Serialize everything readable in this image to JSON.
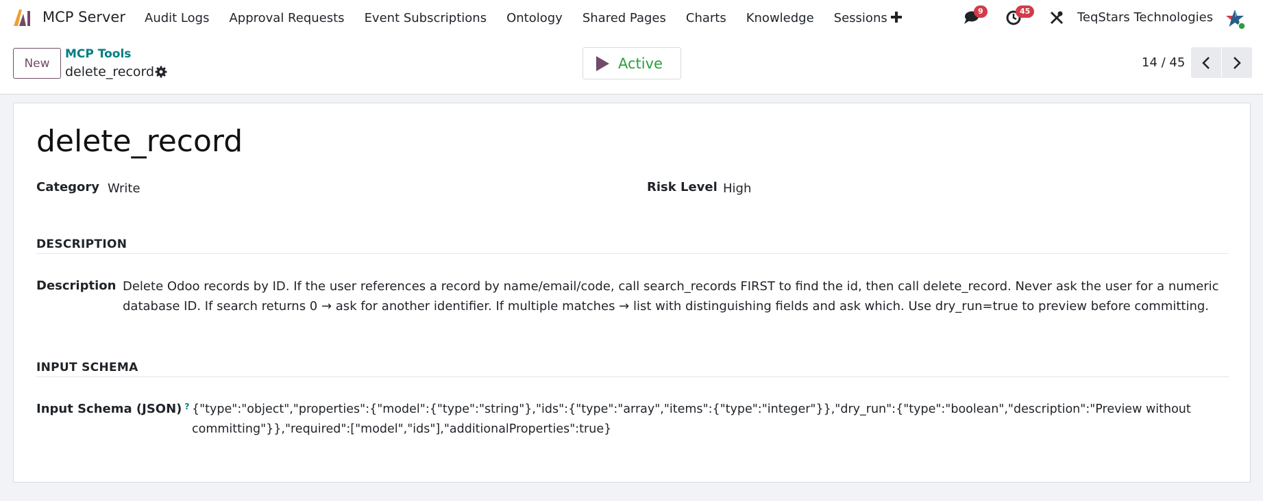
{
  "navbar": {
    "app_name": "MCP Server",
    "menu": [
      "Audit Logs",
      "Approval Requests",
      "Event Subscriptions",
      "Ontology",
      "Shared Pages",
      "Charts",
      "Knowledge",
      "Sessions"
    ],
    "messages_badge": "9",
    "activities_badge": "45",
    "company": "TeqStars Technologies"
  },
  "control_panel": {
    "new_label": "New",
    "breadcrumb_parent": "MCP Tools",
    "breadcrumb_current": "delete_record",
    "status_label": "Active",
    "pager": "14 / 45"
  },
  "form": {
    "title": "delete_record",
    "category_label": "Category",
    "category_value": "Write",
    "risk_label": "Risk Level",
    "risk_value": "High",
    "description_section": "DESCRIPTION",
    "description_label": "Description",
    "description_line1": "Delete Odoo records by ID. If the user references a record by name/email/code, call search_records FIRST to find the id, then call delete_record. Never ask the user for a numeric",
    "description_line2": "database ID. If search returns 0 → ask for another identifier. If multiple matches → list with distinguishing fields and ask which. Use dry_run=true to preview before committing.",
    "schema_section": "INPUT SCHEMA",
    "schema_label": "Input Schema (JSON)",
    "schema_help": "?",
    "schema_line1": "{\"type\":\"object\",\"properties\":{\"model\":{\"type\":\"string\"},\"ids\":{\"type\":\"array\",\"items\":{\"type\":\"integer\"}},\"dry_run\":{\"type\":\"boolean\",\"description\":\"Preview without",
    "schema_line2": "committing\"}},\"required\":[\"model\",\"ids\"],\"additionalProperties\":true}"
  },
  "colors": {
    "brand": "#714b67",
    "link": "#017e84",
    "active": "#28a03c",
    "badge": "#d23c4a"
  },
  "icons": [
    "app-logo-icon",
    "plus-icon",
    "chat-icon",
    "clock-icon",
    "tools-icon",
    "gear-icon",
    "play-icon",
    "chevron-left-icon",
    "chevron-right-icon"
  ]
}
